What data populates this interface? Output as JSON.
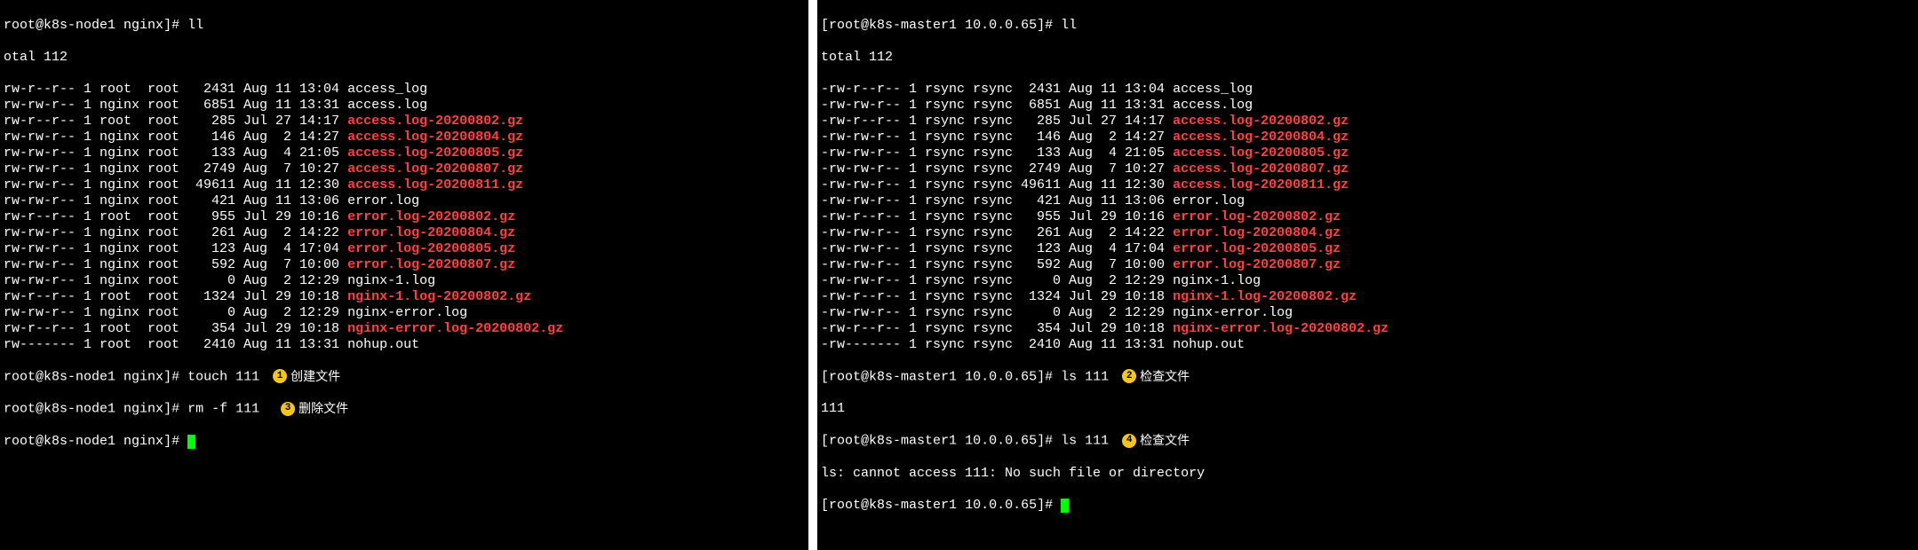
{
  "left": {
    "prompt_host": "root@k8s-node1",
    "prompt_dir": "nginx",
    "cmd_ll": "ll",
    "total": "otal 112",
    "rows": [
      {
        "perm": "rw-r--r--",
        "n": "1",
        "u": "root ",
        "g": "root ",
        "sz": " 2431",
        "dt": "Aug 11 13:04",
        "name": "access_log",
        "red": false
      },
      {
        "perm": "rw-rw-r--",
        "n": "1",
        "u": "nginx",
        "g": "root ",
        "sz": " 6851",
        "dt": "Aug 11 13:31",
        "name": "access.log",
        "red": false
      },
      {
        "perm": "rw-r--r--",
        "n": "1",
        "u": "root ",
        "g": "root ",
        "sz": "  285",
        "dt": "Jul 27 14:17",
        "name": "access.log-20200802.gz",
        "red": true
      },
      {
        "perm": "rw-rw-r--",
        "n": "1",
        "u": "nginx",
        "g": "root ",
        "sz": "  146",
        "dt": "Aug  2 14:27",
        "name": "access.log-20200804.gz",
        "red": true
      },
      {
        "perm": "rw-rw-r--",
        "n": "1",
        "u": "nginx",
        "g": "root ",
        "sz": "  133",
        "dt": "Aug  4 21:05",
        "name": "access.log-20200805.gz",
        "red": true
      },
      {
        "perm": "rw-rw-r--",
        "n": "1",
        "u": "nginx",
        "g": "root ",
        "sz": " 2749",
        "dt": "Aug  7 10:27",
        "name": "access.log-20200807.gz",
        "red": true
      },
      {
        "perm": "rw-rw-r--",
        "n": "1",
        "u": "nginx",
        "g": "root ",
        "sz": "49611",
        "dt": "Aug 11 12:30",
        "name": "access.log-20200811.gz",
        "red": true
      },
      {
        "perm": "rw-rw-r--",
        "n": "1",
        "u": "nginx",
        "g": "root ",
        "sz": "  421",
        "dt": "Aug 11 13:06",
        "name": "error.log",
        "red": false
      },
      {
        "perm": "rw-r--r--",
        "n": "1",
        "u": "root ",
        "g": "root ",
        "sz": "  955",
        "dt": "Jul 29 10:16",
        "name": "error.log-20200802.gz",
        "red": true
      },
      {
        "perm": "rw-rw-r--",
        "n": "1",
        "u": "nginx",
        "g": "root ",
        "sz": "  261",
        "dt": "Aug  2 14:22",
        "name": "error.log-20200804.gz",
        "red": true
      },
      {
        "perm": "rw-rw-r--",
        "n": "1",
        "u": "nginx",
        "g": "root ",
        "sz": "  123",
        "dt": "Aug  4 17:04",
        "name": "error.log-20200805.gz",
        "red": true
      },
      {
        "perm": "rw-rw-r--",
        "n": "1",
        "u": "nginx",
        "g": "root ",
        "sz": "  592",
        "dt": "Aug  7 10:00",
        "name": "error.log-20200807.gz",
        "red": true
      },
      {
        "perm": "rw-rw-r--",
        "n": "1",
        "u": "nginx",
        "g": "root ",
        "sz": "    0",
        "dt": "Aug  2 12:29",
        "name": "nginx-1.log",
        "red": false
      },
      {
        "perm": "rw-r--r--",
        "n": "1",
        "u": "root ",
        "g": "root ",
        "sz": " 1324",
        "dt": "Jul 29 10:18",
        "name": "nginx-1.log-20200802.gz",
        "red": true
      },
      {
        "perm": "rw-rw-r--",
        "n": "1",
        "u": "nginx",
        "g": "root ",
        "sz": "    0",
        "dt": "Aug  2 12:29",
        "name": "nginx-error.log",
        "red": false
      },
      {
        "perm": "rw-r--r--",
        "n": "1",
        "u": "root ",
        "g": "root ",
        "sz": "  354",
        "dt": "Jul 29 10:18",
        "name": "nginx-error.log-20200802.gz",
        "red": true
      },
      {
        "perm": "rw-------",
        "n": "1",
        "u": "root ",
        "g": "root ",
        "sz": " 2410",
        "dt": "Aug 11 13:31",
        "name": "nohup.out",
        "red": false
      }
    ],
    "cmd_touch": "touch 111",
    "cmd_rm": "rm -f 111",
    "annot1": "创建文件",
    "annot2": "删除文件"
  },
  "right": {
    "prompt_host": "root@k8s-master1",
    "prompt_dir": "10.0.0.65",
    "cmd_ll": "ll",
    "total": "total 112",
    "rows": [
      {
        "perm": "-rw-r--r--",
        "n": "1",
        "u": "rsync",
        "g": "rsync",
        "sz": " 2431",
        "dt": "Aug 11 13:04",
        "name": "access_log",
        "red": false
      },
      {
        "perm": "-rw-rw-r--",
        "n": "1",
        "u": "rsync",
        "g": "rsync",
        "sz": " 6851",
        "dt": "Aug 11 13:31",
        "name": "access.log",
        "red": false
      },
      {
        "perm": "-rw-r--r--",
        "n": "1",
        "u": "rsync",
        "g": "rsync",
        "sz": "  285",
        "dt": "Jul 27 14:17",
        "name": "access.log-20200802.gz",
        "red": true
      },
      {
        "perm": "-rw-rw-r--",
        "n": "1",
        "u": "rsync",
        "g": "rsync",
        "sz": "  146",
        "dt": "Aug  2 14:27",
        "name": "access.log-20200804.gz",
        "red": true
      },
      {
        "perm": "-rw-rw-r--",
        "n": "1",
        "u": "rsync",
        "g": "rsync",
        "sz": "  133",
        "dt": "Aug  4 21:05",
        "name": "access.log-20200805.gz",
        "red": true
      },
      {
        "perm": "-rw-rw-r--",
        "n": "1",
        "u": "rsync",
        "g": "rsync",
        "sz": " 2749",
        "dt": "Aug  7 10:27",
        "name": "access.log-20200807.gz",
        "red": true
      },
      {
        "perm": "-rw-rw-r--",
        "n": "1",
        "u": "rsync",
        "g": "rsync",
        "sz": "49611",
        "dt": "Aug 11 12:30",
        "name": "access.log-20200811.gz",
        "red": true
      },
      {
        "perm": "-rw-rw-r--",
        "n": "1",
        "u": "rsync",
        "g": "rsync",
        "sz": "  421",
        "dt": "Aug 11 13:06",
        "name": "error.log",
        "red": false
      },
      {
        "perm": "-rw-r--r--",
        "n": "1",
        "u": "rsync",
        "g": "rsync",
        "sz": "  955",
        "dt": "Jul 29 10:16",
        "name": "error.log-20200802.gz",
        "red": true
      },
      {
        "perm": "-rw-rw-r--",
        "n": "1",
        "u": "rsync",
        "g": "rsync",
        "sz": "  261",
        "dt": "Aug  2 14:22",
        "name": "error.log-20200804.gz",
        "red": true
      },
      {
        "perm": "-rw-rw-r--",
        "n": "1",
        "u": "rsync",
        "g": "rsync",
        "sz": "  123",
        "dt": "Aug  4 17:04",
        "name": "error.log-20200805.gz",
        "red": true
      },
      {
        "perm": "-rw-rw-r--",
        "n": "1",
        "u": "rsync",
        "g": "rsync",
        "sz": "  592",
        "dt": "Aug  7 10:00",
        "name": "error.log-20200807.gz",
        "red": true
      },
      {
        "perm": "-rw-rw-r--",
        "n": "1",
        "u": "rsync",
        "g": "rsync",
        "sz": "    0",
        "dt": "Aug  2 12:29",
        "name": "nginx-1.log",
        "red": false
      },
      {
        "perm": "-rw-r--r--",
        "n": "1",
        "u": "rsync",
        "g": "rsync",
        "sz": " 1324",
        "dt": "Jul 29 10:18",
        "name": "nginx-1.log-20200802.gz",
        "red": true
      },
      {
        "perm": "-rw-rw-r--",
        "n": "1",
        "u": "rsync",
        "g": "rsync",
        "sz": "    0",
        "dt": "Aug  2 12:29",
        "name": "nginx-error.log",
        "red": false
      },
      {
        "perm": "-rw-r--r--",
        "n": "1",
        "u": "rsync",
        "g": "rsync",
        "sz": "  354",
        "dt": "Jul 29 10:18",
        "name": "nginx-error.log-20200802.gz",
        "red": true
      },
      {
        "perm": "-rw-------",
        "n": "1",
        "u": "rsync",
        "g": "rsync",
        "sz": " 2410",
        "dt": "Aug 11 13:31",
        "name": "nohup.out",
        "red": false
      }
    ],
    "cmd_ls1": "ls 111",
    "out_111": "111",
    "cmd_ls2": "ls 111",
    "err_ls": "ls: cannot access 111: No such file or directory",
    "annot3": "检查文件",
    "annot4": "检查文件"
  },
  "badges": {
    "b1": "1",
    "b2": "2",
    "b3": "3",
    "b4": "4"
  }
}
